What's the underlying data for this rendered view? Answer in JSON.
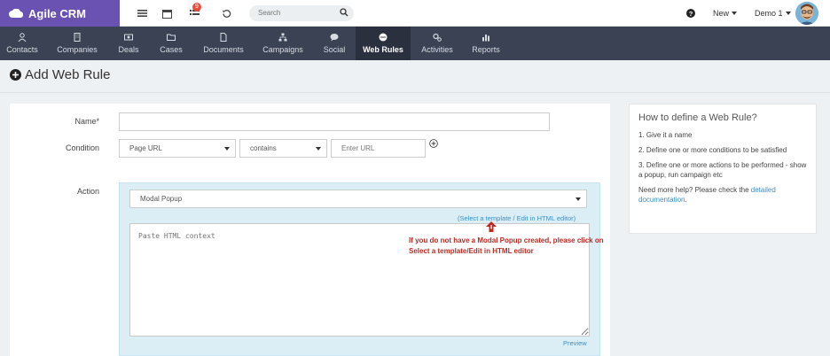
{
  "brand": {
    "name": "Agile CRM"
  },
  "topbar": {
    "notification_count": "9",
    "search_placeholder": "Search",
    "new_label": "New",
    "user_label": "Demo 1"
  },
  "nav": {
    "items": [
      {
        "label": "Contacts",
        "icon": "person-icon"
      },
      {
        "label": "Companies",
        "icon": "building-icon"
      },
      {
        "label": "Deals",
        "icon": "money-icon"
      },
      {
        "label": "Cases",
        "icon": "folder-icon"
      },
      {
        "label": "Documents",
        "icon": "document-icon"
      },
      {
        "label": "Campaigns",
        "icon": "sitemap-icon"
      },
      {
        "label": "Social",
        "icon": "chat-icon"
      },
      {
        "label": "Web Rules",
        "icon": "web-rules-icon"
      },
      {
        "label": "Activities",
        "icon": "gears-icon"
      },
      {
        "label": "Reports",
        "icon": "bar-chart-icon"
      }
    ],
    "active": "Web Rules"
  },
  "page": {
    "title": "Add Web Rule"
  },
  "form": {
    "name_label": "Name*",
    "name_value": "",
    "condition_label": "Condition",
    "condition_field": "Page URL",
    "condition_operator": "contains",
    "url_placeholder": "Enter URL",
    "action_label": "Action",
    "action_value": "Modal Popup",
    "template_link": "(Select a template / Edit in HTML editor)",
    "html_placeholder": "Paste HTML context",
    "preview_link": "Preview",
    "note": "If you do not have a Modal Popup created, please click on Select a template/Edit in HTML editor"
  },
  "help": {
    "title": "How to define a Web Rule?",
    "step1": "1. Give it a name",
    "step2": "2. Define one or more conditions to be satisfied",
    "step3": "3. Define one or more actions to be performed - show a popup, run campaign etc",
    "more_text": "Need more help? Please check the ",
    "more_link": "detailed documentation",
    "more_end": "."
  },
  "colors": {
    "brand": "#6a52b3",
    "nav_bg": "#3a4253",
    "nav_active": "#2a303d",
    "link": "#3a8fc7",
    "note": "#c0271f",
    "action_bg": "#dbeef6"
  }
}
